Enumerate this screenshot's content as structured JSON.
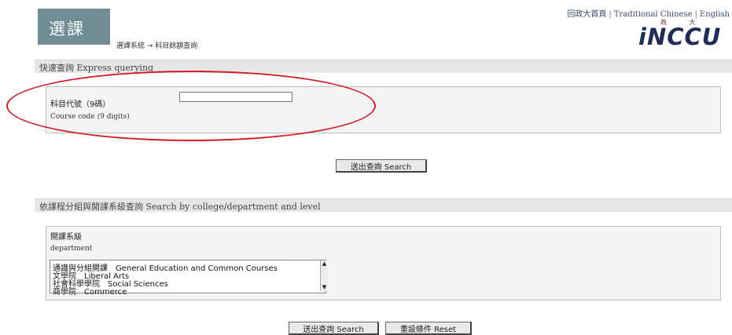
{
  "header": {
    "logo_text": "選課",
    "breadcrumb": "選課系統 → 科目餘額查詢",
    "links": [
      "回政大首頁",
      "Traditional Chinese",
      "English"
    ],
    "brand_name": "iNCCU",
    "brand_chars": "政 大"
  },
  "express": {
    "title": "快速查詢 Express querying",
    "code_label_zh": "科目代號（9碼）",
    "code_label_en": "Course code (9 digits)",
    "code_value": "",
    "search_label": "送出查詢 Search"
  },
  "college": {
    "title": "依課程分組與開課系級查詢 Search by college/department and level",
    "dept_label_zh": "開課系級",
    "dept_label_en": "department",
    "options": [
      "通識與分組開課　General Education and Common Courses",
      "文學院　Liberal Arts",
      "社會科學學院　Social Sciences",
      "商學院　Commerce"
    ],
    "search_label": "送出查詢 Search",
    "reset_label": "重設條件 Reset"
  },
  "colors": {
    "logo_bg": "#6f8d92",
    "annotation_circle": "#d21f26",
    "brand": "#1f2c55"
  }
}
